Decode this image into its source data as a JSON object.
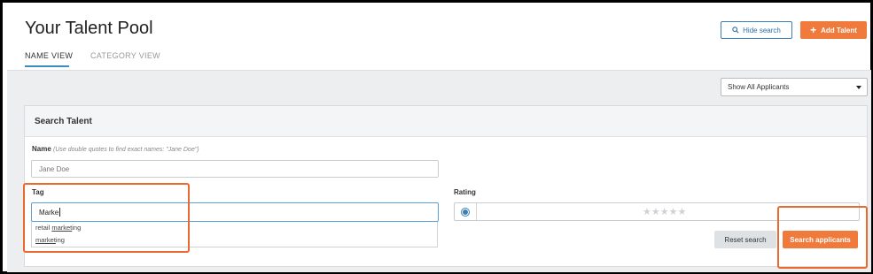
{
  "page": {
    "title": "Your Talent Pool"
  },
  "tabs": [
    {
      "label": "NAME VIEW",
      "active": true
    },
    {
      "label": "CATEGORY VIEW",
      "active": false
    }
  ],
  "header_buttons": {
    "hide_search": "Hide search",
    "add_talent": "Add Talent",
    "add_icon": "plus-icon",
    "hide_icon": "search-icon"
  },
  "filter": {
    "selected": "Show All Applicants"
  },
  "search_card": {
    "title": "Search Talent",
    "name": {
      "label": "Name",
      "hint": "(Use double quotes to find exact names: \"Jane Doe\")",
      "placeholder": "Jane Doe",
      "value": ""
    },
    "tag": {
      "label": "Tag",
      "value": "Marke",
      "suggestions": [
        {
          "text": "retail marketing",
          "before": "retail ",
          "match": "market",
          "after": "ing"
        },
        {
          "text": "marketing",
          "before": "",
          "match": "market",
          "after": "ing"
        }
      ]
    },
    "rating": {
      "label": "Rating",
      "stars_total": 5,
      "stars_filled": 0,
      "radio_selected": true
    },
    "reset_label": "Reset search",
    "search_label": "Search applicants"
  },
  "colors": {
    "accent_orange": "#f07a3c",
    "accent_blue": "#3a7fb6",
    "highlight_box": "#e86a2e"
  }
}
